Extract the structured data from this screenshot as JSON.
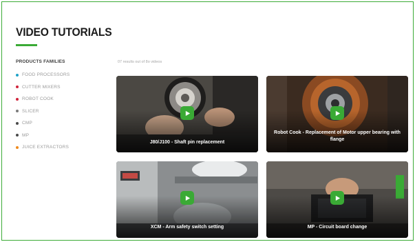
{
  "page": {
    "title": "VIDEO TUTORIALS"
  },
  "sidebar": {
    "heading": "PRODUCTS FAMILIES",
    "items": [
      {
        "label": "FOOD PROCESSORS",
        "color": "#1fa2c8"
      },
      {
        "label": "CUTTER MIXERS",
        "color": "#d0243b"
      },
      {
        "label": "ROBOT COOK",
        "color": "#d0243b"
      },
      {
        "label": "SLICER",
        "color": "#7a7a7a"
      },
      {
        "label": "CMP",
        "color": "#4a4a4a"
      },
      {
        "label": "MP",
        "color": "#4a4a4a"
      },
      {
        "label": "JUICE EXTRACTORS",
        "color": "#f08a1c"
      }
    ]
  },
  "results": {
    "count_text": "07 results out of 8o videos"
  },
  "accent_color": "#3aaa35",
  "videos": [
    {
      "title": "J80/J100 - Shaft pin replacement",
      "icon": "play-icon"
    },
    {
      "title": "Robot Cook - Replacement of Motor upper bearing with flange",
      "icon": "play-icon"
    },
    {
      "title": "XCM - Arm safety switch setting",
      "icon": "play-icon"
    },
    {
      "title": "MP - Circuit board change",
      "icon": "play-icon"
    }
  ]
}
